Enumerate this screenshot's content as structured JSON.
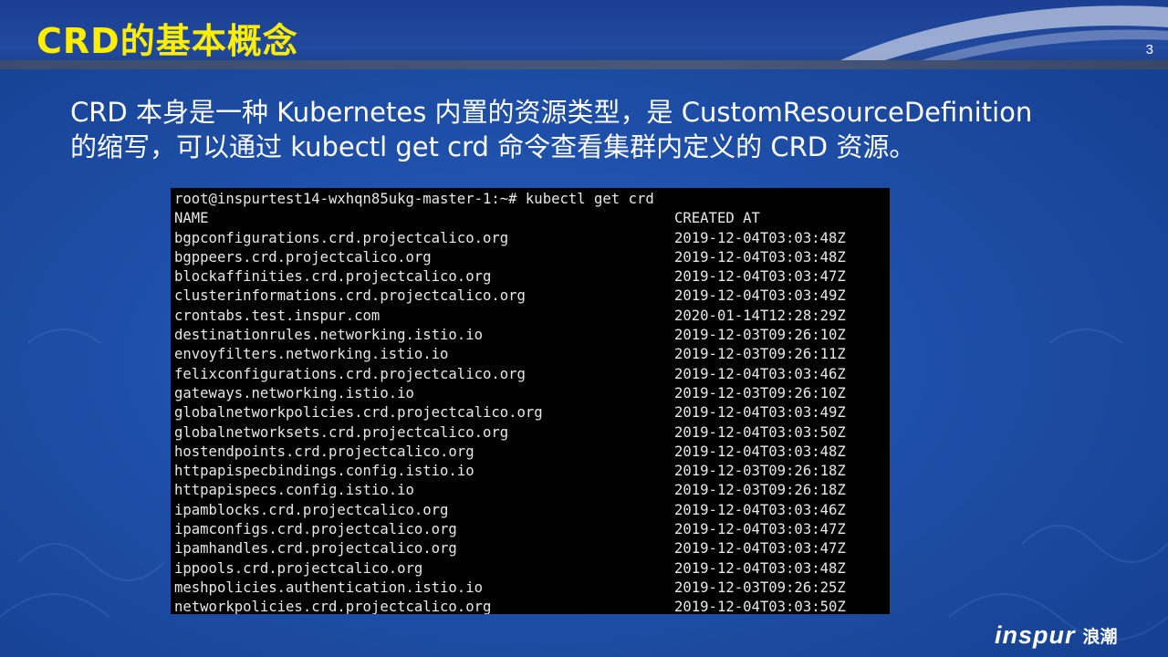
{
  "slide": {
    "title": "CRD的基本概念",
    "page_number": "3",
    "body_line_1": "CRD 本身是一种 Kubernetes 内置的资源类型，是 CustomResourceDefinition",
    "body_line_2": "的缩写，可以通过 kubectl get crd 命令查看集群内定义的 CRD 资源。",
    "logo_text": "inspur",
    "logo_cn": "浪潮"
  },
  "terminal": {
    "prompt_line": "root@inspurtest14-wxhqn85ukg-master-1:~# kubectl get crd",
    "header": {
      "name": "NAME",
      "created": "CREATED AT"
    },
    "rows": [
      {
        "name": "bgpconfigurations.crd.projectcalico.org",
        "created": "2019-12-04T03:03:48Z"
      },
      {
        "name": "bgppeers.crd.projectcalico.org",
        "created": "2019-12-04T03:03:48Z"
      },
      {
        "name": "blockaffinities.crd.projectcalico.org",
        "created": "2019-12-04T03:03:47Z"
      },
      {
        "name": "clusterinformations.crd.projectcalico.org",
        "created": "2019-12-04T03:03:49Z"
      },
      {
        "name": "crontabs.test.inspur.com",
        "created": "2020-01-14T12:28:29Z"
      },
      {
        "name": "destinationrules.networking.istio.io",
        "created": "2019-12-03T09:26:10Z"
      },
      {
        "name": "envoyfilters.networking.istio.io",
        "created": "2019-12-03T09:26:11Z"
      },
      {
        "name": "felixconfigurations.crd.projectcalico.org",
        "created": "2019-12-04T03:03:46Z"
      },
      {
        "name": "gateways.networking.istio.io",
        "created": "2019-12-03T09:26:10Z"
      },
      {
        "name": "globalnetworkpolicies.crd.projectcalico.org",
        "created": "2019-12-04T03:03:49Z"
      },
      {
        "name": "globalnetworksets.crd.projectcalico.org",
        "created": "2019-12-04T03:03:50Z"
      },
      {
        "name": "hostendpoints.crd.projectcalico.org",
        "created": "2019-12-04T03:03:48Z"
      },
      {
        "name": "httpapispecbindings.config.istio.io",
        "created": "2019-12-03T09:26:18Z"
      },
      {
        "name": "httpapispecs.config.istio.io",
        "created": "2019-12-03T09:26:18Z"
      },
      {
        "name": "ipamblocks.crd.projectcalico.org",
        "created": "2019-12-04T03:03:46Z"
      },
      {
        "name": "ipamconfigs.crd.projectcalico.org",
        "created": "2019-12-04T03:03:47Z"
      },
      {
        "name": "ipamhandles.crd.projectcalico.org",
        "created": "2019-12-04T03:03:47Z"
      },
      {
        "name": "ippools.crd.projectcalico.org",
        "created": "2019-12-04T03:03:48Z"
      },
      {
        "name": "meshpolicies.authentication.istio.io",
        "created": "2019-12-03T09:26:25Z"
      },
      {
        "name": "networkpolicies.crd.projectcalico.org",
        "created": "2019-12-04T03:03:50Z"
      }
    ]
  }
}
